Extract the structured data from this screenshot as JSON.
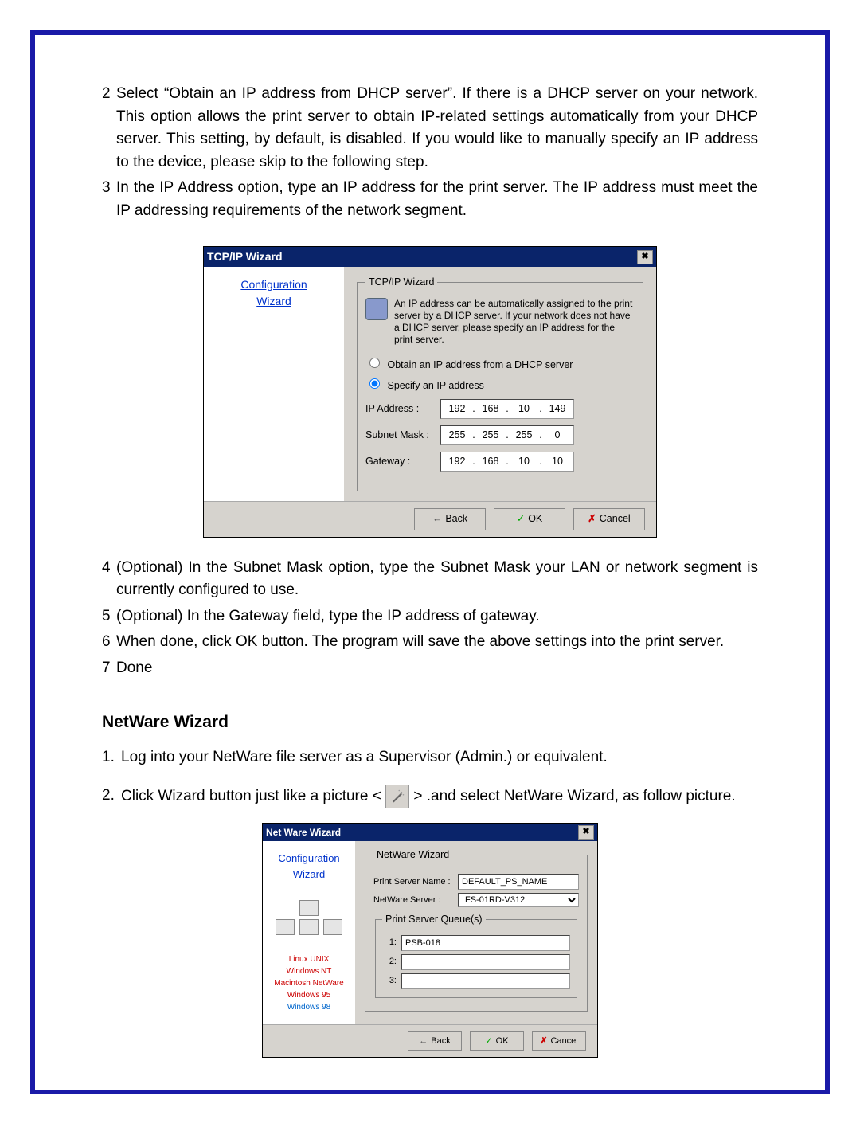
{
  "steps": {
    "s2_num": "2",
    "s2": "Select “Obtain an IP address from DHCP server”. If there is a DHCP server on your network. This option allows the print server to obtain IP-related settings automatically from your DHCP server. This setting, by default, is disabled. If you would like to manually specify an IP address to the device, please skip to the following step.",
    "s3_num": "3",
    "s3": "In the IP Address option, type an IP address for the print server. The IP address must meet the IP addressing requirements of the network segment.",
    "s4_num": "4",
    "s4": "(Optional) In the Subnet Mask option, type the Subnet Mask your LAN or network segment is currently configured to use.",
    "s5_num": "5",
    "s5": "(Optional) In the Gateway field, type the IP address of gateway.",
    "s6_num": "6",
    "s6": "When done, click OK button. The program will save the above settings into the print server.",
    "s7_num": "7",
    "s7": "Done"
  },
  "section_netware": "NetWare Wizard",
  "nw_steps": {
    "n1_num": "1.",
    "n1": "Log into your NetWare file server as a Supervisor (Admin.) or equivalent.",
    "n2_num": "2.",
    "n2a": "Click Wizard button just like a picture  <",
    "n2b": "> .and select NetWare Wizard, as follow picture."
  },
  "dlg1": {
    "title": "TCP/IP Wizard",
    "close": "✖",
    "sidebar1": "Configuration",
    "sidebar2": "Wizard",
    "legend": "TCP/IP Wizard",
    "desc": "An IP address can be automatically assigned to the print server by a DHCP server. If your network does not have a DHCP server, please specify an IP address for the print server.",
    "radio1": "Obtain an IP address from a DHCP server",
    "radio2": "Specify an IP address",
    "ip_lbl": "IP Address :",
    "mask_lbl": "Subnet Mask :",
    "gw_lbl": "Gateway :",
    "ip": [
      "192",
      "168",
      "10",
      "149"
    ],
    "mask": [
      "255",
      "255",
      "255",
      "0"
    ],
    "gw": [
      "192",
      "168",
      "10",
      "10"
    ],
    "btn_back": "Back",
    "btn_ok": "OK",
    "btn_cancel": "Cancel"
  },
  "dlg2": {
    "title": "Net Ware Wizard",
    "close": "✖",
    "sidebar1": "Configuration",
    "sidebar2": "Wizard",
    "os1": "Linux  UNIX",
    "os2": "Windows NT",
    "os3": "Macintosh  NetWare",
    "os4": "Windows 95",
    "os5": "Windows 98",
    "legend": "NetWare Wizard",
    "psn_lbl": "Print Server Name :",
    "psn_val": "DEFAULT_PS_NAME",
    "ns_lbl": "NetWare Server :",
    "ns_val": "FS-01RD-V312",
    "queues_legend": "Print Server Queue(s)",
    "q1_lbl": "1:",
    "q1_val": "PSB-018",
    "q2_lbl": "2:",
    "q2_val": "",
    "q3_lbl": "3:",
    "q3_val": "",
    "btn_back": "Back",
    "btn_ok": "OK",
    "btn_cancel": "Cancel"
  }
}
